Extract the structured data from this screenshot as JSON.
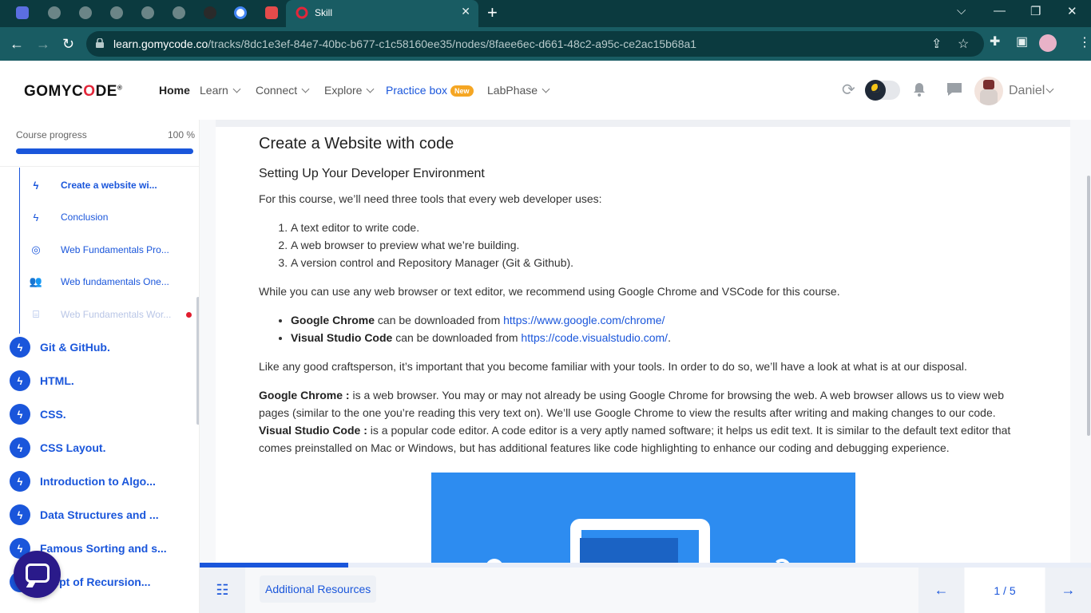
{
  "browser": {
    "active_tab_title": "Skill",
    "url_domain": "learn.gomycode.co",
    "url_path": "/tracks/8dc1e3ef-84e7-40bc-b677-c1c58160ee35/nodes/8faee6ec-d661-48c2-a95c-ce2ac15b68a1",
    "theme_color": "#195c63"
  },
  "header": {
    "logo": {
      "before": "GOMYC",
      "o": "O",
      "after": "DE",
      "mark": "®"
    },
    "nav": {
      "home": "Home",
      "learn": "Learn",
      "connect": "Connect",
      "explore": "Explore",
      "practice_box": "Practice box",
      "practice_badge": "New",
      "labphase": "LabPhase"
    },
    "user_name": "Daniel"
  },
  "sidebar": {
    "progress_label": "Course progress",
    "progress_value": "100 %",
    "progress_fraction": 1.0,
    "sub_items": [
      {
        "label": "Create a website wi...",
        "icon": "bolt-icon",
        "state": "current"
      },
      {
        "label": "Conclusion",
        "icon": "bolt-icon",
        "state": "normal"
      },
      {
        "label": "Web Fundamentals Pro...",
        "icon": "target-icon",
        "state": "normal"
      },
      {
        "label": "Web fundamentals One...",
        "icon": "people-icon",
        "state": "normal"
      },
      {
        "label": "Web Fundamentals Wor...",
        "icon": "workshop-icon",
        "state": "muted"
      }
    ],
    "chapters": [
      "Git & GitHub.",
      "HTML.",
      "CSS.",
      "CSS Layout.",
      "Introduction to Algo...",
      "Data Structures and ...",
      "Famous Sorting and s...",
      "ncept of Recursion..."
    ]
  },
  "lesson": {
    "title": "Create a Website with code",
    "subtitle": "Setting Up Your Developer Environment",
    "intro": "For this course, we’ll need three tools that every web developer uses:",
    "tools": [
      "A text editor to write code.",
      "A web browser to preview what we’re building.",
      "A version control and Repository Manager (Git & Github)."
    ],
    "recommend": "While you can use any web browser or text editor, we recommend using Google Chrome and VSCode for this course.",
    "downloads": [
      {
        "name": "Google Chrome",
        "text": " can be downloaded from ",
        "link": "https://www.google.com/chrome/",
        "end": ""
      },
      {
        "name": "Visual Studio Code",
        "text": " can be downloaded from ",
        "link": "https://code.visualstudio.com/",
        "end": "."
      }
    ],
    "craftsperson": "Like any good craftsperson, it’s important that you become familiar with your tools. In order to do so, we’ll have a look at what is at our disposal.",
    "chrome_label": "Google Chrome :",
    "chrome_desc": " is a web browser. You may or may not already be using Google Chrome for browsing the web. A web browser allows us to view web pages (similar to the one you’re reading this very text on). We’ll use Google Chrome to view the results after writing and making changes to our code.",
    "vscode_label": "Visual Studio Code :",
    "vscode_desc": " is a popular code editor. A code editor is a very aptly named software; it helps us edit text. It is similar to the default text editor that comes preinstalled on Mac or Windows, but has additional features like code highlighting to enhance our coding and debugging experience."
  },
  "bottom": {
    "resources_label": "Additional Resources",
    "pager": "1 / 5",
    "lesson_progress_fraction": 0.167
  },
  "colors": {
    "accent": "#1a56db",
    "badge": "#f5a623",
    "alert_dot": "#e11d2e",
    "chat_fab": "#2a1a8a"
  }
}
